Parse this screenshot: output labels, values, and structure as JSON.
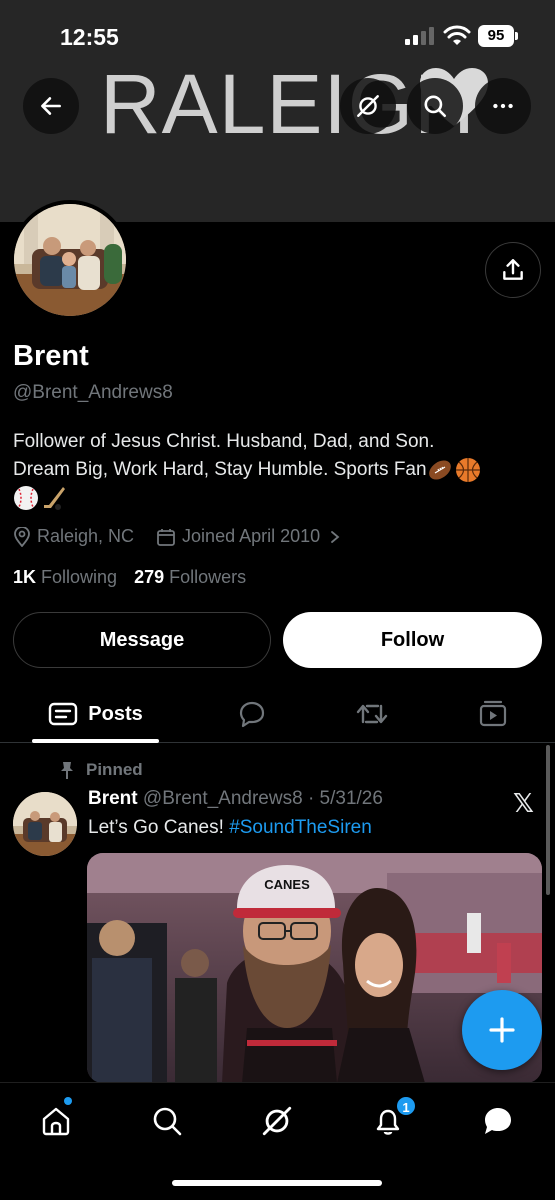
{
  "status_bar": {
    "time": "12:55",
    "battery": "95"
  },
  "banner": {
    "text": "RALEIGH"
  },
  "profile": {
    "name": "Brent",
    "handle": "@Brent_Andrews8",
    "bio_line1": "Follower of Jesus Christ. Husband, Dad, and Son.",
    "bio_line2": "Dream Big, Work Hard, Stay Humble. Sports Fan",
    "location": "Raleigh, NC",
    "joined": "Joined April 2010",
    "following_count": "1K",
    "following_label": "Following",
    "followers_count": "279",
    "followers_label": "Followers"
  },
  "actions": {
    "message_label": "Message",
    "follow_label": "Follow"
  },
  "tabs": {
    "posts_label": "Posts"
  },
  "post": {
    "pinned_label": "Pinned",
    "author": "Brent",
    "meta": "@Brent_Andrews8 · 5/31/26",
    "text": "Let’s Go Canes!",
    "hashtag": "#SoundTheSiren",
    "hat_text": "CANES"
  },
  "nav": {
    "notification_count": "1"
  },
  "colors": {
    "accent": "#1d9bf0",
    "background": "#000000",
    "muted": "#71767b"
  }
}
